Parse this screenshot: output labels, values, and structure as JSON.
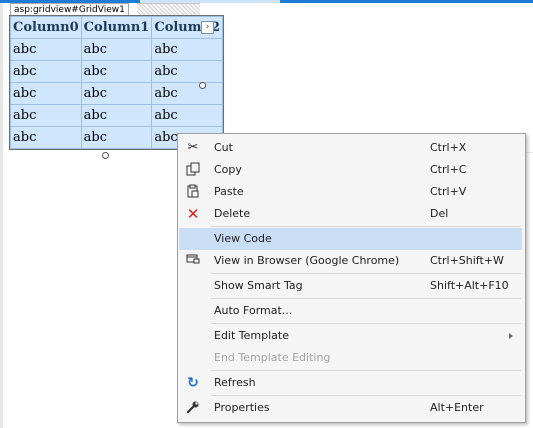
{
  "designer": {
    "control_label": "asp:gridview#GridView1",
    "smart_tag_glyph": "›"
  },
  "grid": {
    "columns": [
      "Column0",
      "Column1",
      "Column2"
    ],
    "rows": [
      [
        "abc",
        "abc",
        "abc"
      ],
      [
        "abc",
        "abc",
        "abc"
      ],
      [
        "abc",
        "abc",
        "abc"
      ],
      [
        "abc",
        "abc",
        "abc"
      ],
      [
        "abc",
        "abc",
        "abc"
      ]
    ]
  },
  "context_menu": {
    "items": [
      {
        "label": "Cut",
        "shortcut": "Ctrl+X",
        "icon": "scissors-icon"
      },
      {
        "label": "Copy",
        "shortcut": "Ctrl+C",
        "icon": "copy-icon"
      },
      {
        "label": "Paste",
        "shortcut": "Ctrl+V",
        "icon": "paste-icon"
      },
      {
        "label": "Delete",
        "shortcut": "Del",
        "icon": "delete-icon"
      },
      {
        "label": "View Code",
        "shortcut": "",
        "highlighted": true
      },
      {
        "label": "View in Browser (Google Chrome)",
        "shortcut": "Ctrl+Shift+W",
        "icon": "browser-icon"
      },
      {
        "label": "Show Smart Tag",
        "shortcut": "Shift+Alt+F10"
      },
      {
        "label": "Auto Format...",
        "shortcut": ""
      },
      {
        "label": "Edit Template",
        "shortcut": "",
        "submenu": true
      },
      {
        "label": "End Template Editing",
        "shortcut": "",
        "disabled": true
      },
      {
        "label": "Refresh",
        "shortcut": "",
        "icon": "refresh-icon"
      },
      {
        "label": "Properties",
        "shortcut": "Alt+Enter",
        "icon": "wrench-icon"
      }
    ]
  },
  "colors": {
    "grid_bg": "#cfe6fc",
    "menu_bg": "#f5f5f5",
    "highlight": "#c9ddf4",
    "delete_icon": "#d9241b",
    "refresh_icon": "#1e6fc9"
  }
}
